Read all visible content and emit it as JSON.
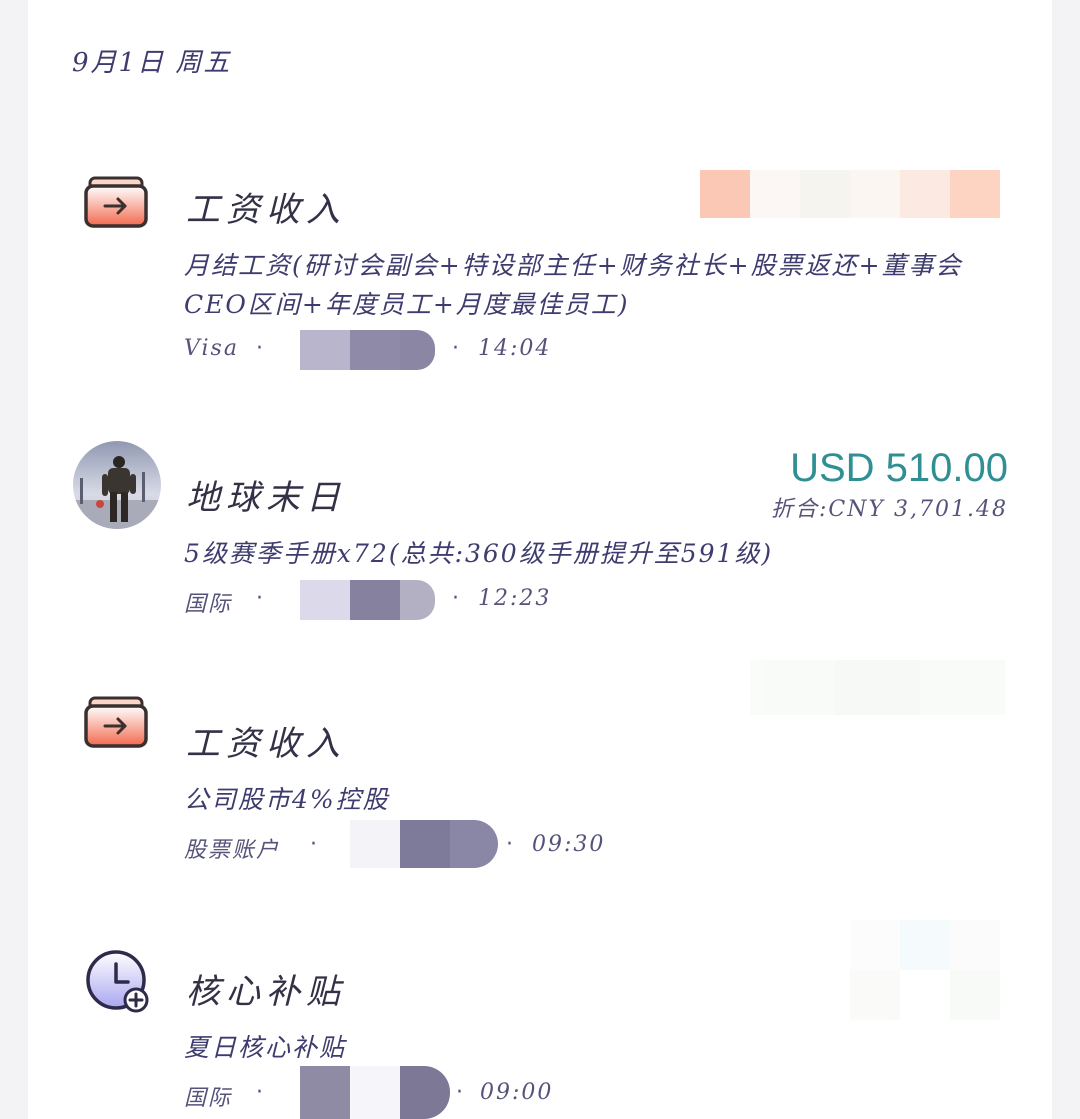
{
  "date_header": "9月1日 周五",
  "transactions": [
    {
      "icon": "wallet-income-icon",
      "title": "工资收入",
      "description": "月结工资(研讨会副会+特设部主任+财务社长+股票返还+董事会CEO区间+年度员工+月度最佳员工)",
      "account": "Visa",
      "separator": "·",
      "time": "14:04"
    },
    {
      "icon": "game-avatar-icon",
      "title": "地球末日",
      "amount": "USD 510.00",
      "converted": "折合:CNY 3,701.48",
      "description": "5级赛季手册x72(总共:360级手册提升至591级)",
      "account": "国际",
      "separator": "·",
      "time": "12:23"
    },
    {
      "icon": "wallet-income-icon",
      "title": "工资收入",
      "description": "公司股市4%控股",
      "account": "股票账户",
      "separator": "·",
      "time": "09:30"
    },
    {
      "icon": "clock-add-icon",
      "title": "核心补贴",
      "description": "夏日核心补贴",
      "account": "国际",
      "separator": "·",
      "time": "09:00"
    }
  ],
  "colors": {
    "amount": "#2f8f92",
    "text": "#3e3c6e",
    "wallet_fill": "#f27a5e",
    "clock_fill": "#b9b6f2"
  }
}
